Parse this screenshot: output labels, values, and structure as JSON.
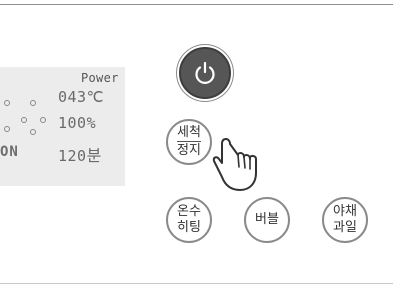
{
  "display": {
    "power_label": "Power",
    "temperature": "043℃",
    "percent": "100%",
    "time_value": "120",
    "time_unit": "분",
    "status_text": "ON"
  },
  "buttons": {
    "wash_stop": {
      "line1": "세척",
      "line2": "정지"
    },
    "heating": {
      "line1": "온수",
      "line2": "히팅"
    },
    "bubble": {
      "label": "버블"
    },
    "vegetable_fruit": {
      "line1": "야채",
      "line2": "과일"
    }
  },
  "icons": {
    "power": "power-icon",
    "pointer": "hand-pointer-icon"
  },
  "colors": {
    "power_button_bg": "#565656",
    "lcd_bg": "#ececec",
    "button_border": "#8a8a8a"
  }
}
